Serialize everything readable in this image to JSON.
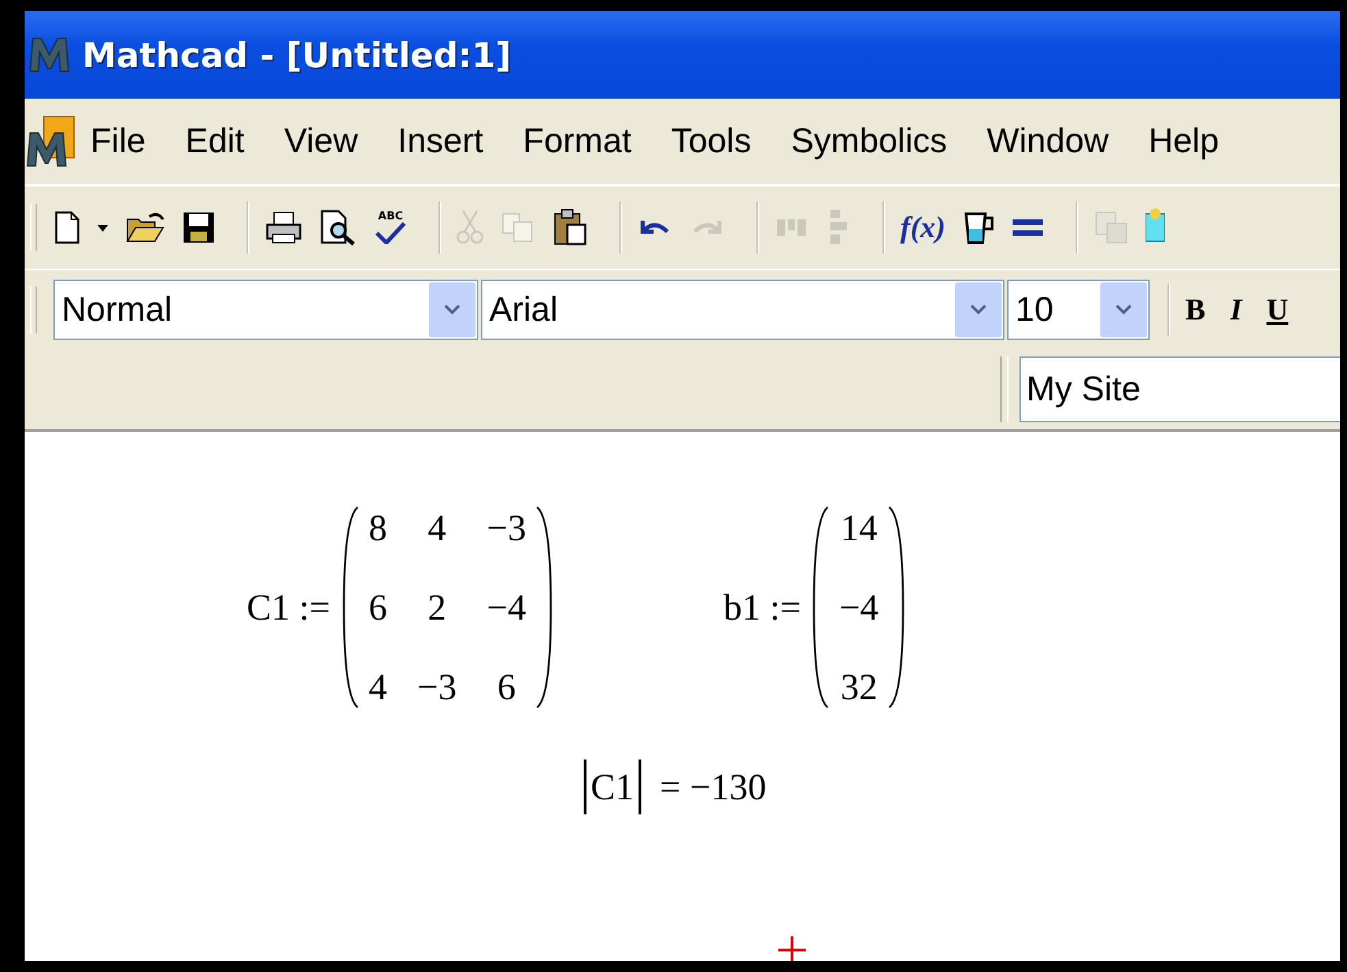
{
  "window": {
    "title": "Mathcad - [Untitled:1]"
  },
  "menu": [
    {
      "label": "File"
    },
    {
      "label": "Edit"
    },
    {
      "label": "View"
    },
    {
      "label": "Insert"
    },
    {
      "label": "Format"
    },
    {
      "label": "Tools"
    },
    {
      "label": "Symbolics"
    },
    {
      "label": "Window"
    },
    {
      "label": "Help"
    }
  ],
  "toolbar": [
    {
      "kind": "new",
      "disabled": false
    },
    {
      "kind": "dropdown",
      "disabled": false
    },
    {
      "kind": "open",
      "disabled": false
    },
    {
      "kind": "save",
      "disabled": false
    },
    {
      "kind": "separator"
    },
    {
      "kind": "print",
      "disabled": false
    },
    {
      "kind": "preview",
      "disabled": false
    },
    {
      "kind": "spell",
      "label": "ABC",
      "disabled": false
    },
    {
      "kind": "separator"
    },
    {
      "kind": "cut",
      "disabled": true
    },
    {
      "kind": "copy",
      "disabled": true
    },
    {
      "kind": "paste",
      "disabled": false
    },
    {
      "kind": "separator"
    },
    {
      "kind": "undo",
      "disabled": false
    },
    {
      "kind": "redo",
      "disabled": true
    },
    {
      "kind": "separator"
    },
    {
      "kind": "align-across",
      "disabled": true
    },
    {
      "kind": "align-down",
      "disabled": true
    },
    {
      "kind": "separator"
    },
    {
      "kind": "function",
      "label": "f(x)",
      "disabled": false
    },
    {
      "kind": "unit",
      "disabled": false
    },
    {
      "kind": "equals",
      "disabled": false
    },
    {
      "kind": "separator"
    },
    {
      "kind": "component",
      "disabled": true
    },
    {
      "kind": "resource",
      "disabled": false
    }
  ],
  "format_bar": {
    "style": "Normal",
    "font": "Arial",
    "size": "10",
    "buttons": [
      {
        "label": "B",
        "kind": "bold"
      },
      {
        "label": "I",
        "kind": "italic"
      },
      {
        "label": "U",
        "kind": "underline"
      }
    ]
  },
  "url_bar": {
    "value": "My Site"
  },
  "worksheet": {
    "matrices": [
      {
        "name": "C1",
        "operator": ":=",
        "rows": [
          [
            "8",
            "4",
            "−3"
          ],
          [
            "6",
            "2",
            "−4"
          ],
          [
            "4",
            "−3",
            "6"
          ]
        ]
      },
      {
        "name": "b1",
        "operator": ":=",
        "rows": [
          [
            "14"
          ],
          [
            "−4"
          ],
          [
            "32"
          ]
        ]
      }
    ],
    "determinant": {
      "name": "C1",
      "operator": "=",
      "result": "−130"
    }
  }
}
